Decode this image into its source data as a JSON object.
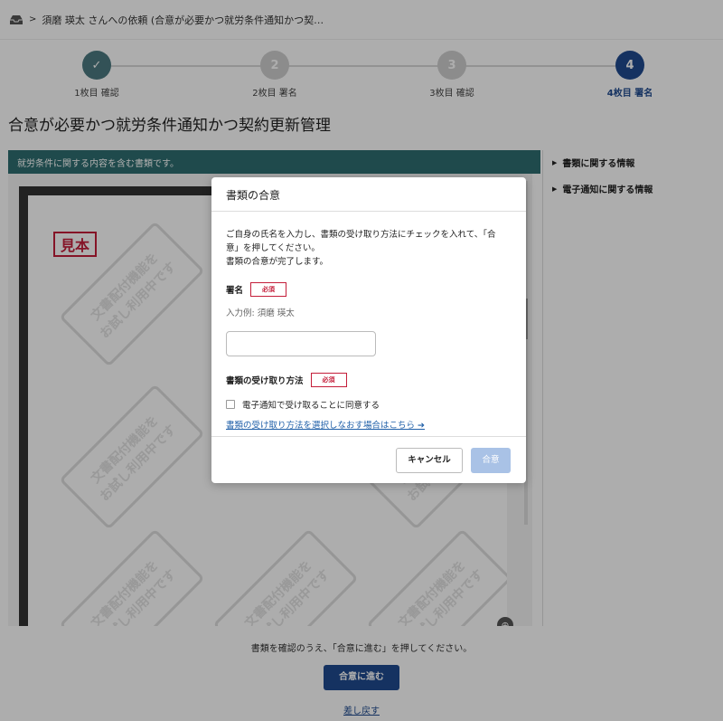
{
  "header": {
    "icon": "inbox-icon",
    "breadcrumb": "須磨 瑛太 さんへの依頼 (合意が必要かつ就労条件通知かつ契…"
  },
  "stepper": {
    "steps": [
      {
        "label": "1枚目 確認",
        "number": "✓",
        "state": "done"
      },
      {
        "label": "2枚目 署名",
        "number": "2",
        "state": "todo"
      },
      {
        "label": "3枚目 確認",
        "number": "3",
        "state": "todo"
      },
      {
        "label": "4枚目 署名",
        "number": "4",
        "state": "active"
      }
    ]
  },
  "document": {
    "title": "合意が必要かつ就労条件通知かつ契約更新管理",
    "viewer_header": "就労条件に関する内容を含む書類です。",
    "stamp": "見本",
    "watermark_line1": "文書配付機能を",
    "watermark_line2": "お試し利用中です"
  },
  "sidepanel": {
    "items": [
      {
        "label": "書類に関する情報"
      },
      {
        "label": "電子通知に関する情報"
      }
    ]
  },
  "footer": {
    "message": "書類を確認のうえ、「合意に進む」を押してください。",
    "proceed_label": "合意に進む",
    "sendback_label": "差し戻す"
  },
  "modal": {
    "title": "書類の合意",
    "desc_line1": "ご自身の氏名を入力し、書類の受け取り方法にチェックを入れて、「合",
    "desc_line2": "意」を押してください。",
    "desc_line3": "書類の合意が完了します。",
    "signature_label": "署名",
    "required": "必須",
    "example": "入力例: 須磨 瑛太",
    "name_value": "",
    "receive_label": "書類の受け取り方法",
    "consent_label": "電子通知で受け取ることに同意する",
    "change_link": "書類の受け取り方法を選択しなおす場合はこちら ➔",
    "cancel_label": "キャンセル",
    "agree_label": "合意"
  },
  "colors": {
    "primary": "#1f4b8f",
    "teal": "#2f6e70",
    "required": "#c41e3a",
    "agree_disabled": "#a9c2e6"
  }
}
